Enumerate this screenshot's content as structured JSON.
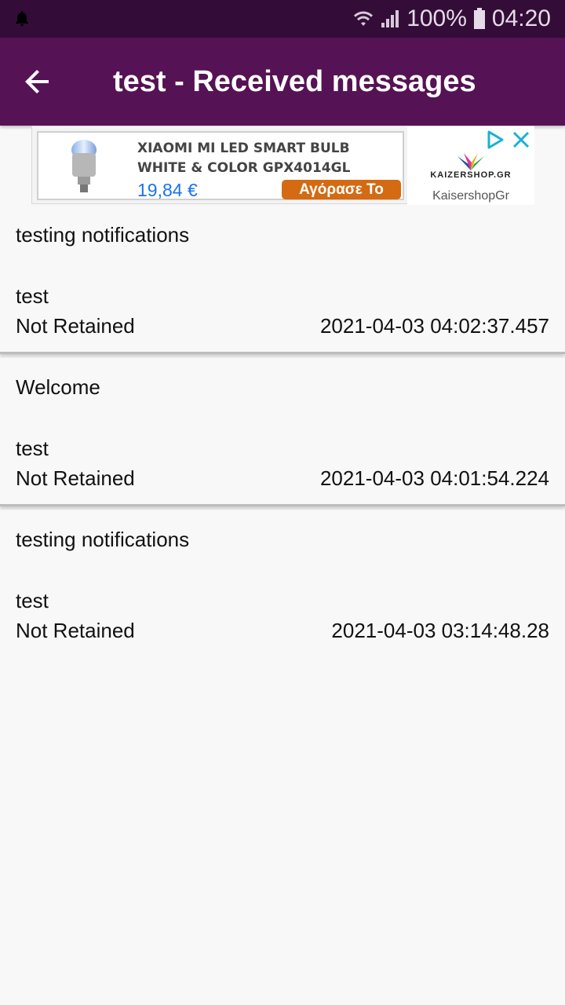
{
  "status_bar": {
    "battery_text": "100%",
    "time": "04:20",
    "icons": [
      "notification-bell-icon",
      "wifi-icon",
      "signal-icon",
      "battery-icon"
    ]
  },
  "app_bar": {
    "title": "test - Received messages",
    "back_icon": "arrow-left-icon",
    "color": "#551254"
  },
  "ad": {
    "product": "XIAOMI MI LED SMART BULB WHITE & COLOR GPX4014GL",
    "price": "19,84 €",
    "cta": "Αγόρασε Το",
    "logo_text": "KAIZERSHOP.GR",
    "advertiser": "KaisershopGr"
  },
  "messages": [
    {
      "title": "testing notifications",
      "body": "test",
      "retained": "Not Retained",
      "timestamp": "2021-04-03 04:02:37.457"
    },
    {
      "title": "Welcome",
      "body": "test",
      "retained": "Not Retained",
      "timestamp": "2021-04-03 04:01:54.224"
    },
    {
      "title": "testing notifications",
      "body": "test",
      "retained": "Not Retained",
      "timestamp": "2021-04-03 03:14:48.28"
    }
  ]
}
